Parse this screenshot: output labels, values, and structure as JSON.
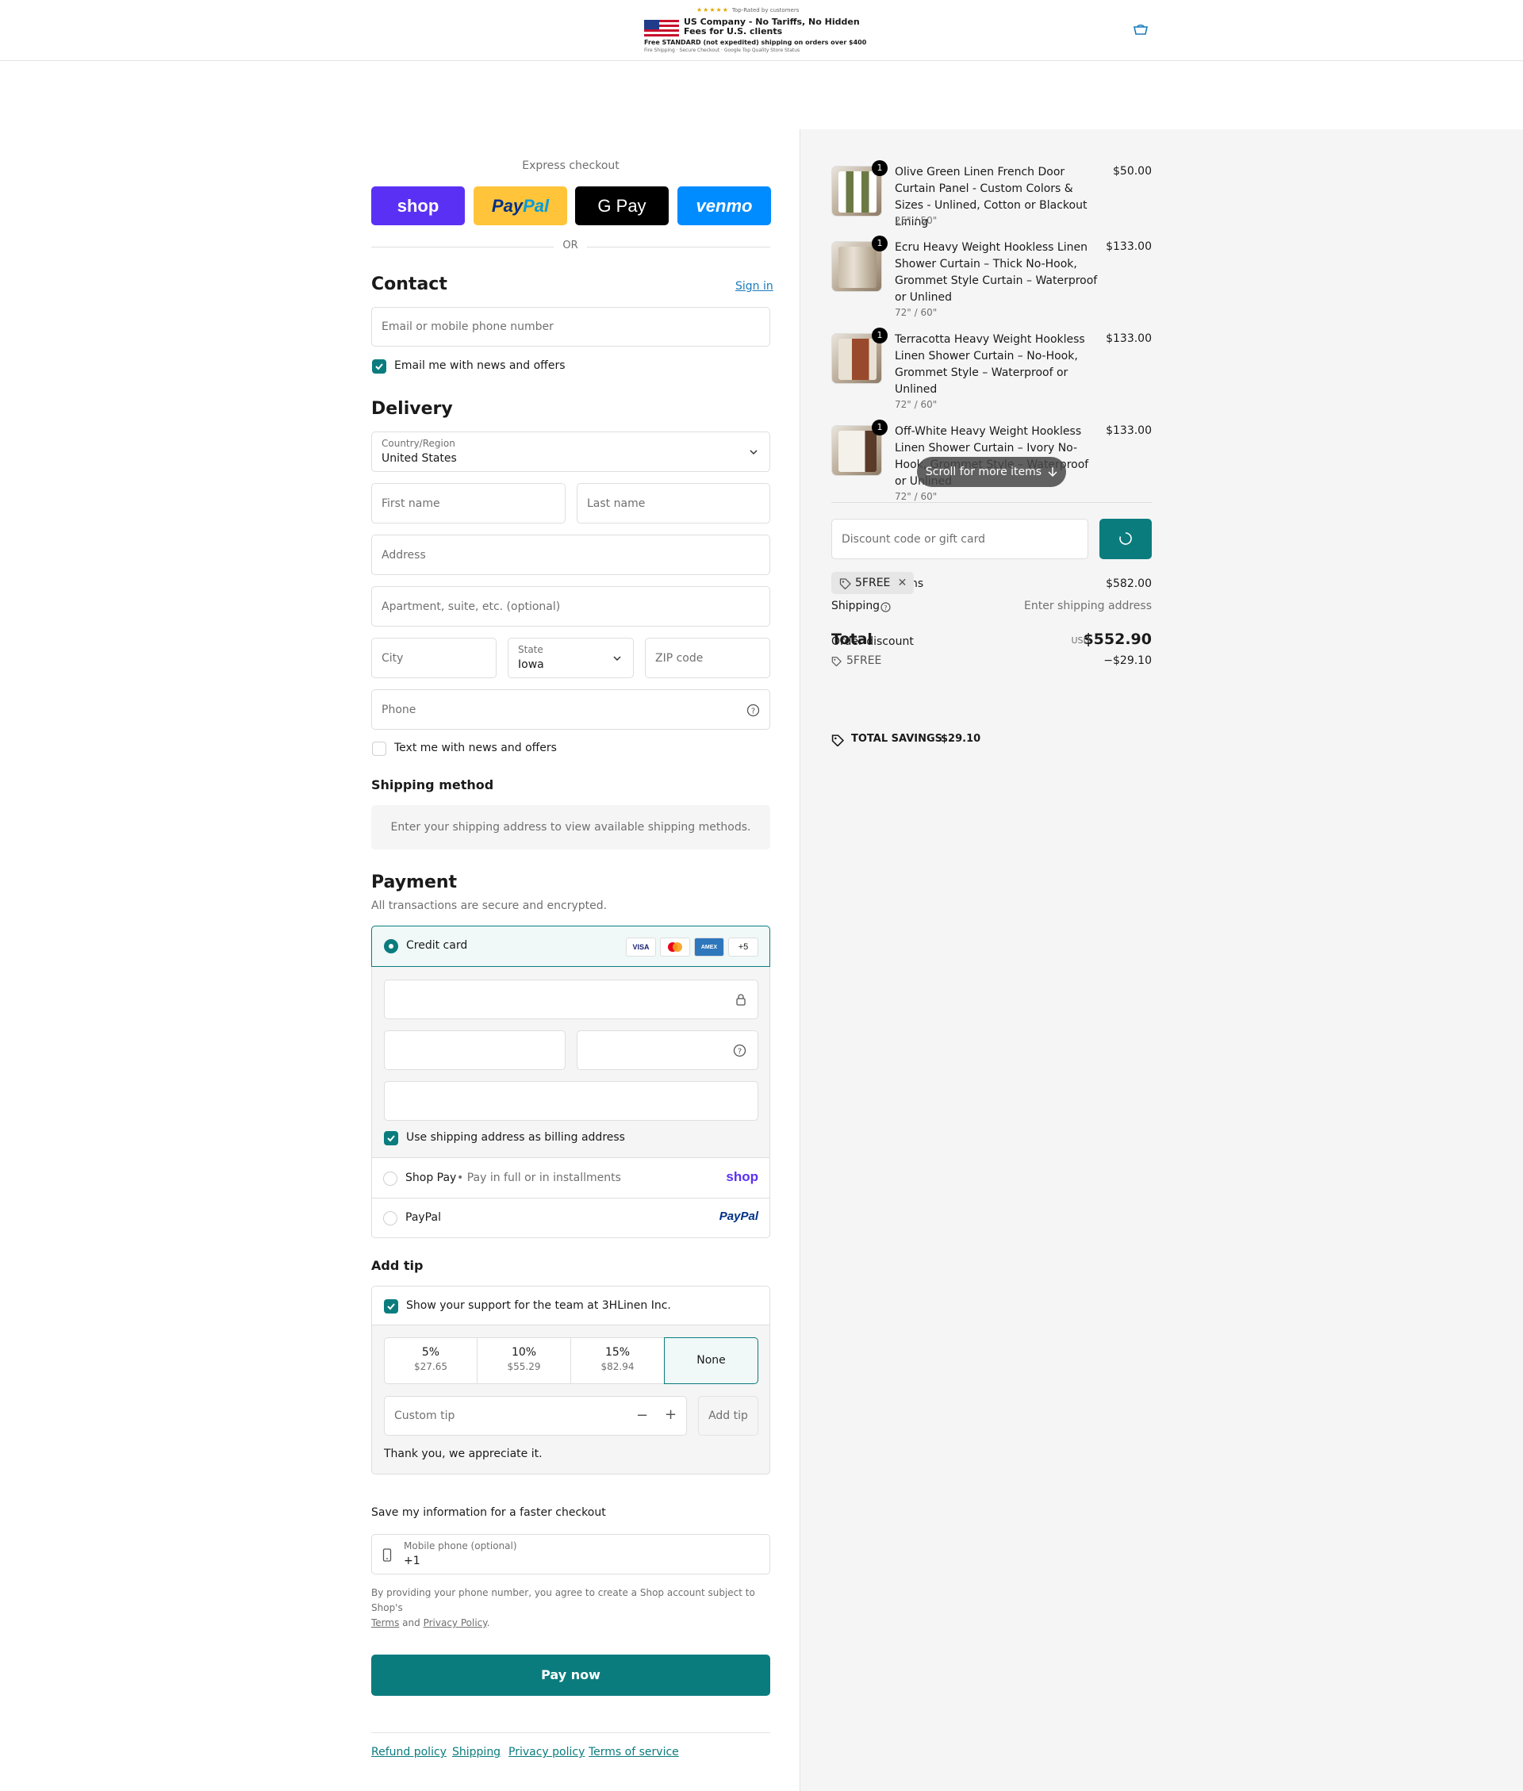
{
  "header": {
    "banner": {
      "stars": "★★★★★",
      "rating_text": "Top-Rated by customers",
      "line1": "US Company - No Tariffs, No Hidden Fees for U.S. clients",
      "line2": "Free STANDARD (not expedited) shipping on orders over $400",
      "line3": "Fire Shipping · Secure Checkout · Google Top Quality Store Status"
    },
    "cart_icon": "cart-icon"
  },
  "express": {
    "title": "Express checkout",
    "shop": "shop",
    "paypal_a": "Pay",
    "paypal_b": "Pal",
    "gpay": "G Pay",
    "venmo": "venmo",
    "or": "OR"
  },
  "contact": {
    "heading": "Contact",
    "sign_in": "Sign in",
    "email_placeholder": "Email or mobile phone number",
    "news_label": "Email me with news and offers"
  },
  "delivery": {
    "heading": "Delivery",
    "country_label": "Country/Region",
    "country_value": "United States",
    "first_name": "First name",
    "last_name": "Last name",
    "address": "Address",
    "apartment": "Apartment, suite, etc. (optional)",
    "city": "City",
    "state_label": "State",
    "state_value": "Iowa",
    "zip": "ZIP code",
    "phone": "Phone",
    "text_label": "Text me with news and offers"
  },
  "shipping_method": {
    "heading": "Shipping method",
    "message": "Enter your shipping address to view available shipping methods."
  },
  "payment": {
    "heading": "Payment",
    "subtitle": "All transactions are secure and encrypted.",
    "credit_card": "Credit card",
    "logos": [
      "VISA",
      "MC",
      "AMEX",
      "+5"
    ],
    "billing_label": "Use shipping address as billing address",
    "shop_pay": "Shop Pay",
    "shop_pay_sub": "Pay in full or in installments",
    "shop_logo": "shop",
    "paypal": "PayPal",
    "paypal_logo": "PayPal"
  },
  "tip": {
    "heading": "Add tip",
    "support_label": "Show your support for the team at 3HLinen Inc.",
    "options": [
      {
        "pct": "5%",
        "amount": "$27.65"
      },
      {
        "pct": "10%",
        "amount": "$55.29"
      },
      {
        "pct": "15%",
        "amount": "$82.94"
      },
      {
        "pct": "None",
        "amount": ""
      }
    ],
    "custom_placeholder": "Custom tip",
    "add_button": "Add tip",
    "thanks": "Thank you, we appreciate it."
  },
  "save_info": {
    "heading": "Save my information for a faster checkout",
    "mobile_label": "Mobile phone (optional)",
    "mobile_value": "+1",
    "legal_a": "By providing your phone number, you agree to create a Shop account subject to Shop's",
    "terms": "Terms",
    "and": "and",
    "privacy": "Privacy Policy",
    "period": "."
  },
  "pay_now": "Pay now",
  "footer": [
    "Refund policy",
    "Shipping",
    "Privacy policy",
    "Terms of service"
  ],
  "summary": {
    "items": [
      {
        "qty": "1",
        "title": "Olive Green Linen French Door Curtain Panel - Custom Colors & Sizes - Unlined, Cotton or Blackout Lining",
        "variant": "25\" / 50\"",
        "price": "$50.00"
      },
      {
        "qty": "1",
        "title": "Ecru Heavy Weight Hookless Linen Shower Curtain – Thick No-Hook, Grommet Style Curtain – Waterproof or Unlined",
        "variant": "72\" / 60\"",
        "price": "$133.00"
      },
      {
        "qty": "1",
        "title": "Terracotta Heavy Weight Hookless Linen Shower Curtain – No-Hook, Grommet Style – Waterproof or Unlined",
        "variant": "72\" / 60\"",
        "price": "$133.00"
      },
      {
        "qty": "1",
        "title": "Off-White Heavy Weight Hookless Linen Shower Curtain – Ivory No-Hook, Grommet Style – Waterproof or Unlined",
        "variant": "72\" / 60\"",
        "price": "$133.00"
      }
    ],
    "scroll_hint": "Scroll for more items",
    "discount_placeholder": "Discount code or gift card",
    "code_chip": "5FREE",
    "subtotal_label": "ns",
    "subtotal_value": "$582.00",
    "shipping_label": "Shipping",
    "shipping_value": "Enter shipping address",
    "total_label": "Total",
    "currency": "USD",
    "total_value": "$552.90",
    "order_discount_label": "Order discount",
    "discount_code": "5FREE",
    "discount_value": "−$29.10",
    "savings_label": "TOTAL SAVINGS",
    "savings_value": "$29.10"
  }
}
